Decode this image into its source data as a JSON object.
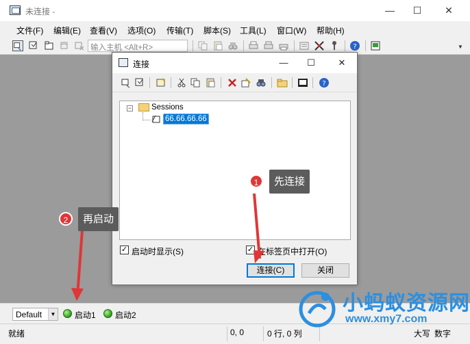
{
  "window": {
    "title": "未连接 -"
  },
  "menu": [
    "文件(F)",
    "编辑(E)",
    "查看(V)",
    "选项(O)",
    "传输(T)",
    "脚本(S)",
    "工具(L)",
    "窗口(W)",
    "帮助(H)"
  ],
  "toolbar": {
    "host_placeholder": "输入主机 <Alt+R>"
  },
  "dialog": {
    "title": "连接",
    "tree": {
      "root_label": "Sessions",
      "session_label": "66.66.66.66"
    },
    "show_on_startup_label": "启动时显示(S)",
    "show_on_startup_checked": true,
    "open_in_tab_label": "在标签页中打开(O)",
    "open_in_tab_checked": true,
    "connect_label": "连接(C)",
    "close_label": "关闭"
  },
  "buttonbar": {
    "profile_value": "Default",
    "launch1": "启动1",
    "launch2": "启动2"
  },
  "status": {
    "ready": "就绪",
    "coords": "0, 0",
    "rowcol": "0 行, 0 列",
    "caps": "大写",
    "num": "数字"
  },
  "annotations": {
    "step1_number": "1",
    "step1_text": "先连接",
    "step2_number": "2",
    "step2_text": "再启动",
    "arrow_color": "#e03636"
  },
  "watermark": {
    "name": "小蚂蚁资源网",
    "url": "www.xmy7.com",
    "color": "#2c8fe0"
  }
}
